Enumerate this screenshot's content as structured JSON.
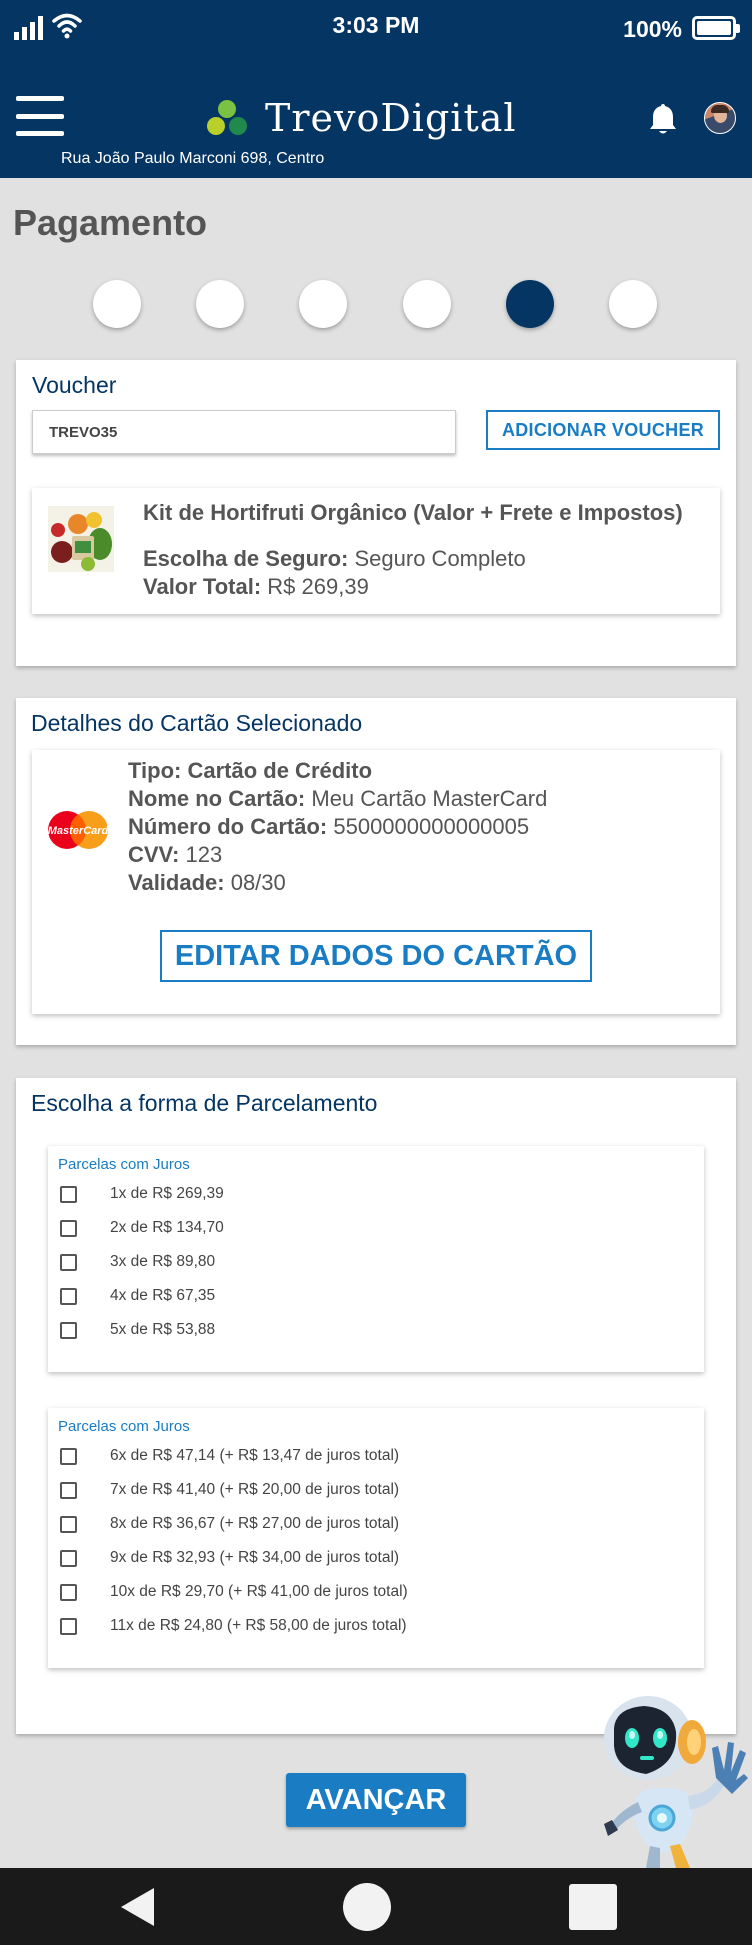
{
  "status_bar": {
    "time": "3:03 PM",
    "battery": "100%"
  },
  "header": {
    "brand": "TrevoDigital",
    "address": "Rua João Paulo Marconi 698, Centro"
  },
  "page": {
    "title": "Pagamento"
  },
  "stepper": {
    "total_steps": 6,
    "current_step": 5
  },
  "voucher": {
    "title": "Voucher",
    "code": "TREVO35",
    "add_label": "ADICIONAR VOUCHER"
  },
  "product": {
    "name": "Kit de Hortifruti Orgânico (Valor + Frete e Impostos)",
    "insurance_label": "Escolha de Seguro:",
    "insurance_value": " Seguro Completo",
    "total_label": "Valor Total:",
    "total_value": " R$ 269,39"
  },
  "card_details": {
    "title": "Detalhes do Cartão Selecionado",
    "type_label": "Tipo: Cartão de Crédito",
    "name_label": "Nome no Cartão:",
    "name_value": " Meu Cartão MasterCard",
    "number_label": "Número do Cartão:",
    "number_value": " 5500000000000005",
    "cvv_label": "CVV:",
    "cvv_value": " 123",
    "validity_label": "Validade:",
    "validity_value": " 08/30",
    "brand_logo_text": "MasterCard",
    "edit_label": "EDITAR DADOS DO CARTÃO"
  },
  "installments": {
    "title": "Escolha a forma de Parcelamento",
    "groups": [
      {
        "title": "Parcelas com Juros",
        "options": [
          "1x de R$ 269,39",
          "2x de R$ 134,70",
          "3x de R$ 89,80",
          "4x de R$ 67,35",
          "5x de R$ 53,88"
        ]
      },
      {
        "title": "Parcelas com Juros",
        "options": [
          "6x de R$ 47,14 (+ R$ 13,47 de juros total)",
          "7x de R$ 41,40 (+ R$ 20,00 de juros total)",
          "8x de R$ 36,67 (+ R$ 27,00 de juros total)",
          "9x de R$ 32,93 (+ R$ 34,00 de juros total)",
          "10x de R$ 29,70 (+ R$ 41,00 de juros total)",
          "11x de R$ 24,80 (+ R$ 58,00 de juros total)"
        ]
      }
    ]
  },
  "actions": {
    "advance_label": "AVANÇAR"
  },
  "colors": {
    "primary": "#053563",
    "accent": "#1a7dc4",
    "background": "#e1e1e1"
  },
  "icons": [
    "signal-icon",
    "wifi-icon",
    "battery-icon",
    "menu-icon",
    "clover-logo-icon",
    "bell-icon",
    "mastercard-icon",
    "robot-mascot-icon",
    "back-icon",
    "home-icon",
    "recent-apps-icon"
  ]
}
